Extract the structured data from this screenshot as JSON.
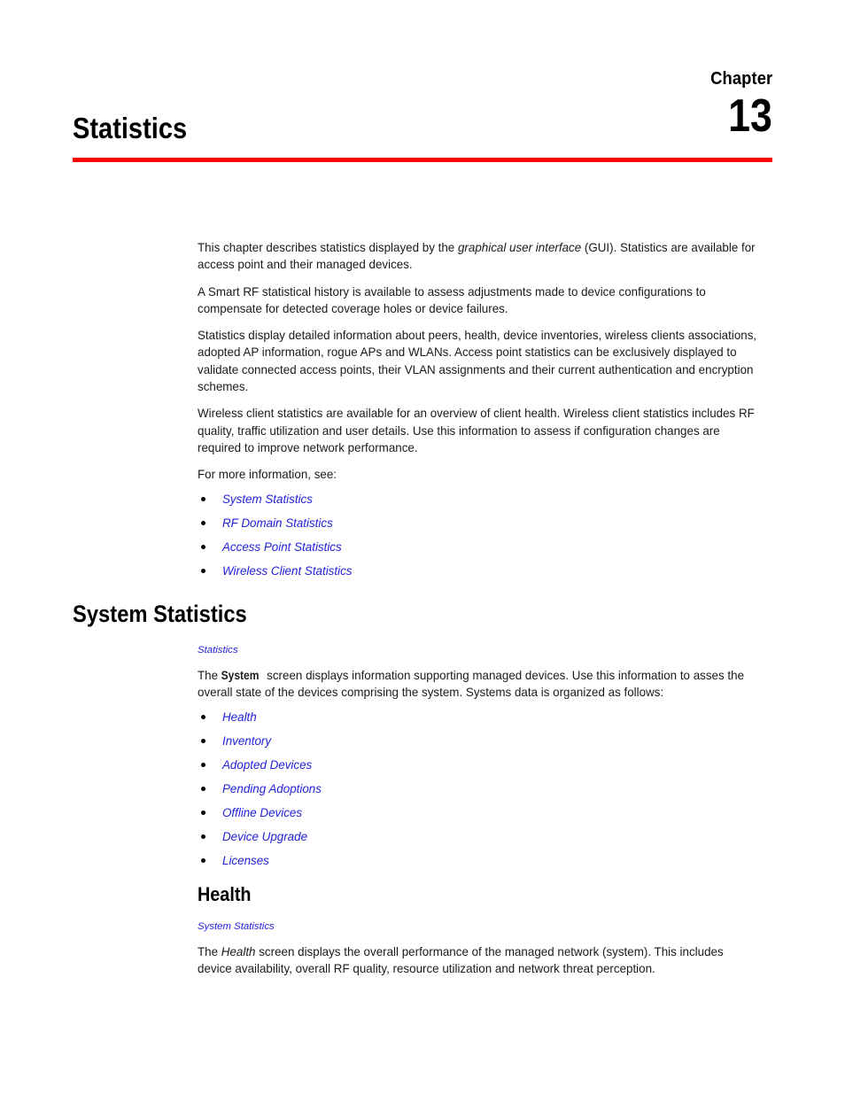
{
  "chapter": {
    "label": "Chapter",
    "number": "13",
    "title": "Statistics",
    "rule_color": "#fc0000"
  },
  "link_color": "#2222dd",
  "intro": {
    "p1_a": "This chapter describes statistics displayed by the ",
    "p1_em": "graphical user interface",
    "p1_b": " (GUI). Statistics are available for access point and their managed devices.",
    "p2": "A Smart RF statistical history is available to assess adjustments made to device configurations to compensate for detected coverage holes or device failures.",
    "p3": "Statistics display detailed information about peers, health, device inventories, wireless clients associations, adopted AP information, rogue APs and WLANs. Access point statistics can be exclusively displayed to validate connected access points, their VLAN assignments and their current authentication and encryption schemes.",
    "p4": "Wireless client statistics are available for an overview of client health. Wireless client statistics includes RF quality, traffic utilization and user details. Use this information to assess if configuration changes are required to improve network performance.",
    "p5": "For more information, see:",
    "links": [
      "System Statistics",
      "RF Domain Statistics",
      "Access Point Statistics",
      "Wireless Client Statistics"
    ]
  },
  "system_statistics": {
    "heading": "System Statistics",
    "breadcrumb": "Statistics",
    "intro_a": "The ",
    "intro_bold": "System",
    "intro_b": " screen displays information supporting managed devices. Use this information to asses the overall state of the devices comprising the system. Systems data is organized as follows:",
    "links": [
      "Health",
      "Inventory",
      "Adopted Devices",
      "Pending Adoptions",
      "Offline Devices",
      "Device Upgrade",
      "Licenses"
    ]
  },
  "health": {
    "heading": "Health",
    "breadcrumb": "System Statistics",
    "intro_a": "The ",
    "intro_em": "Health",
    "intro_b": " screen displays the overall performance of the managed network (system). This includes device availability, overall RF quality, resource utilization and network threat perception."
  }
}
